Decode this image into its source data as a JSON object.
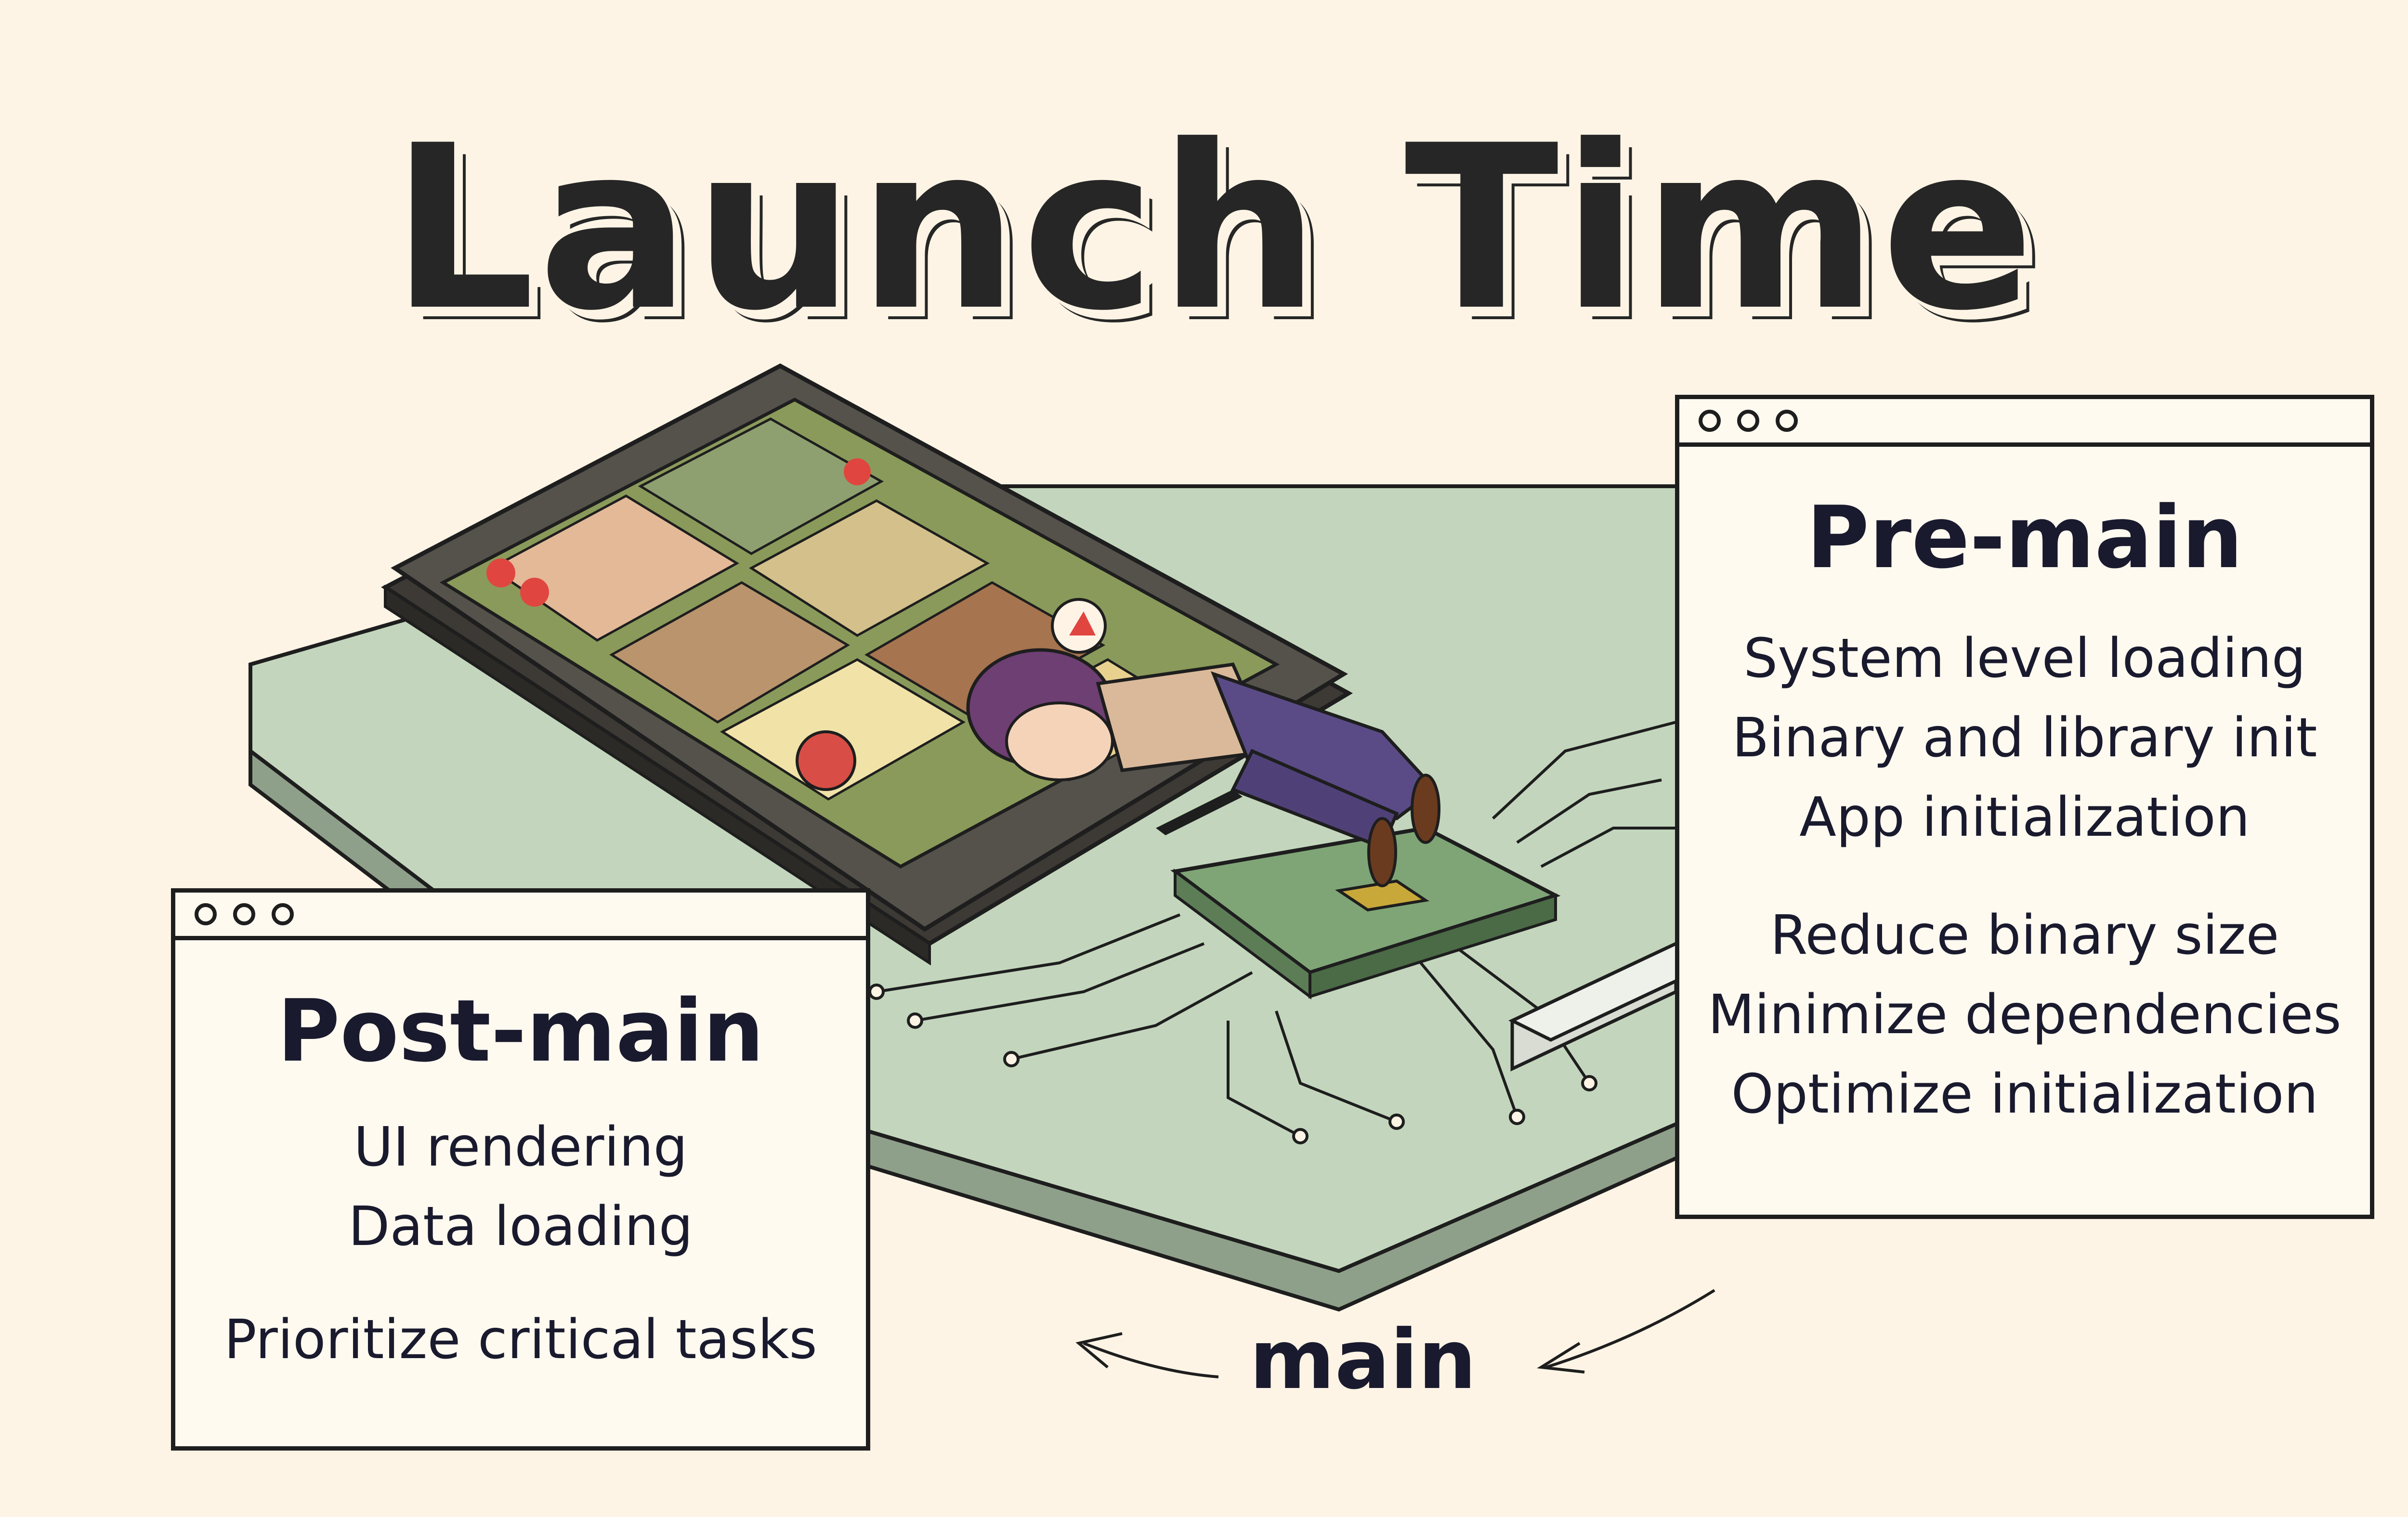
{
  "title": "Launch Time",
  "premain": {
    "heading": "Pre-main",
    "stages": [
      "System level loading",
      "Binary and library init",
      "App initialization"
    ],
    "tips": [
      "Reduce binary size",
      "Minimize dependencies",
      "Optimize initialization"
    ]
  },
  "postmain": {
    "heading": "Post-main",
    "stages": [
      "UI rendering",
      "Data loading"
    ],
    "tips": [
      "Prioritize critical tasks"
    ]
  },
  "main_label": "main",
  "colors": {
    "background": "#fdf4e5",
    "board": "#c3d6bd",
    "phone_body": "#55524c",
    "screen": "#8a9a5a",
    "ink": "#1a1a2e"
  }
}
